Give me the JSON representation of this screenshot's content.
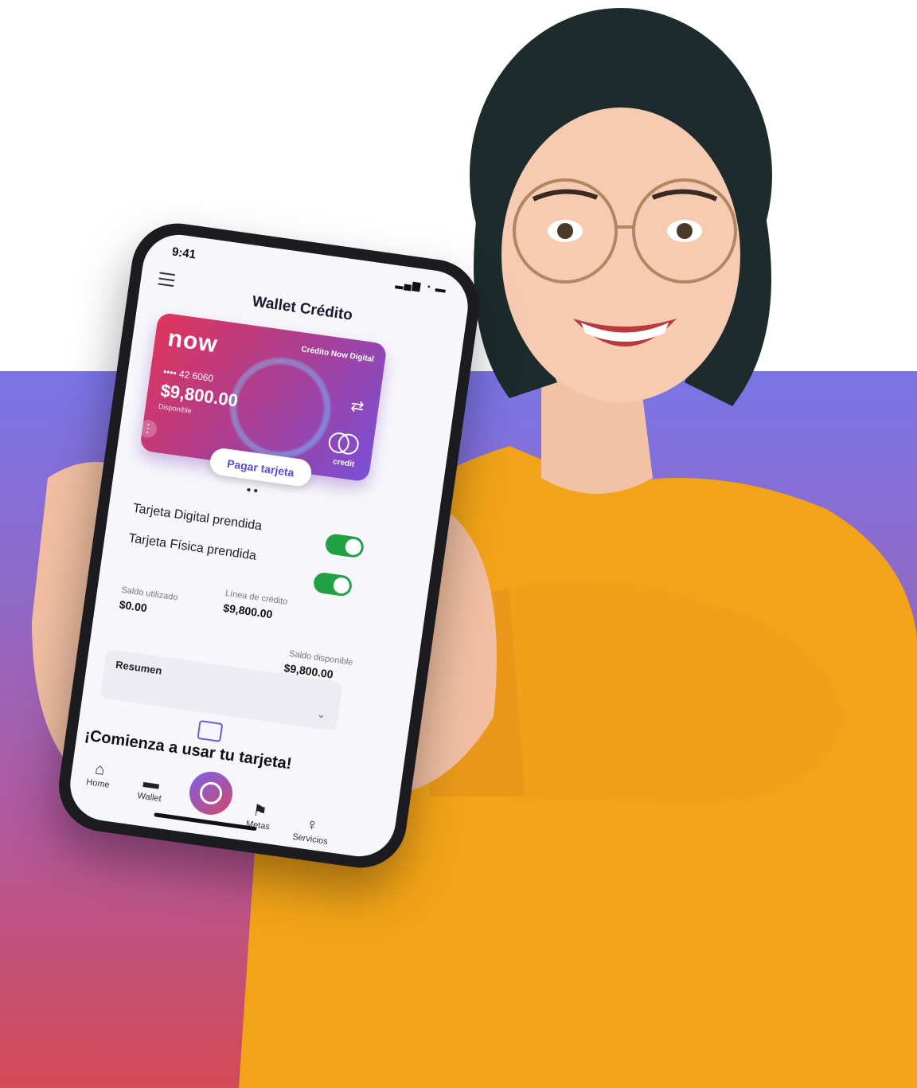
{
  "status_bar": {
    "time": "9:41",
    "signal": "▂▄▆ ◔ ▬"
  },
  "header": {
    "title": "Wallet Crédito"
  },
  "card": {
    "logo": "now",
    "product": "Crédito Now Digital",
    "number": "•••• 42 6060",
    "amount": "$9,800.00",
    "amount_label": "Disponible",
    "network_label": "credit"
  },
  "pay_button": {
    "label": "Pagar tarjeta"
  },
  "toggles": [
    {
      "label": "Tarjeta Digital prendida",
      "on": true
    },
    {
      "label": "Tarjeta Física prendida",
      "on": true
    }
  ],
  "stats": {
    "used_label": "Saldo utilizado",
    "used_value": "$0.00",
    "line_label": "Línea de crédito",
    "line_value": "$9,800.00",
    "available_label": "Saldo disponible",
    "available_value": "$9,800.00"
  },
  "summary": {
    "label": "Resumen"
  },
  "cta": {
    "text": "¡Comienza a usar tu tarjeta!"
  },
  "tabs": [
    {
      "label": "Home",
      "icon": "home-icon"
    },
    {
      "label": "Wallet",
      "icon": "wallet-icon"
    },
    {
      "label": "Metas",
      "icon": "flag-icon"
    },
    {
      "label": "Servicios",
      "icon": "lightbulb-icon"
    }
  ],
  "colors": {
    "accent": "#6a5ce0",
    "toggle_on": "#22a045",
    "sweater": "#f2a418",
    "band_top": "#7b74e6",
    "band_bottom": "#d44a55"
  }
}
